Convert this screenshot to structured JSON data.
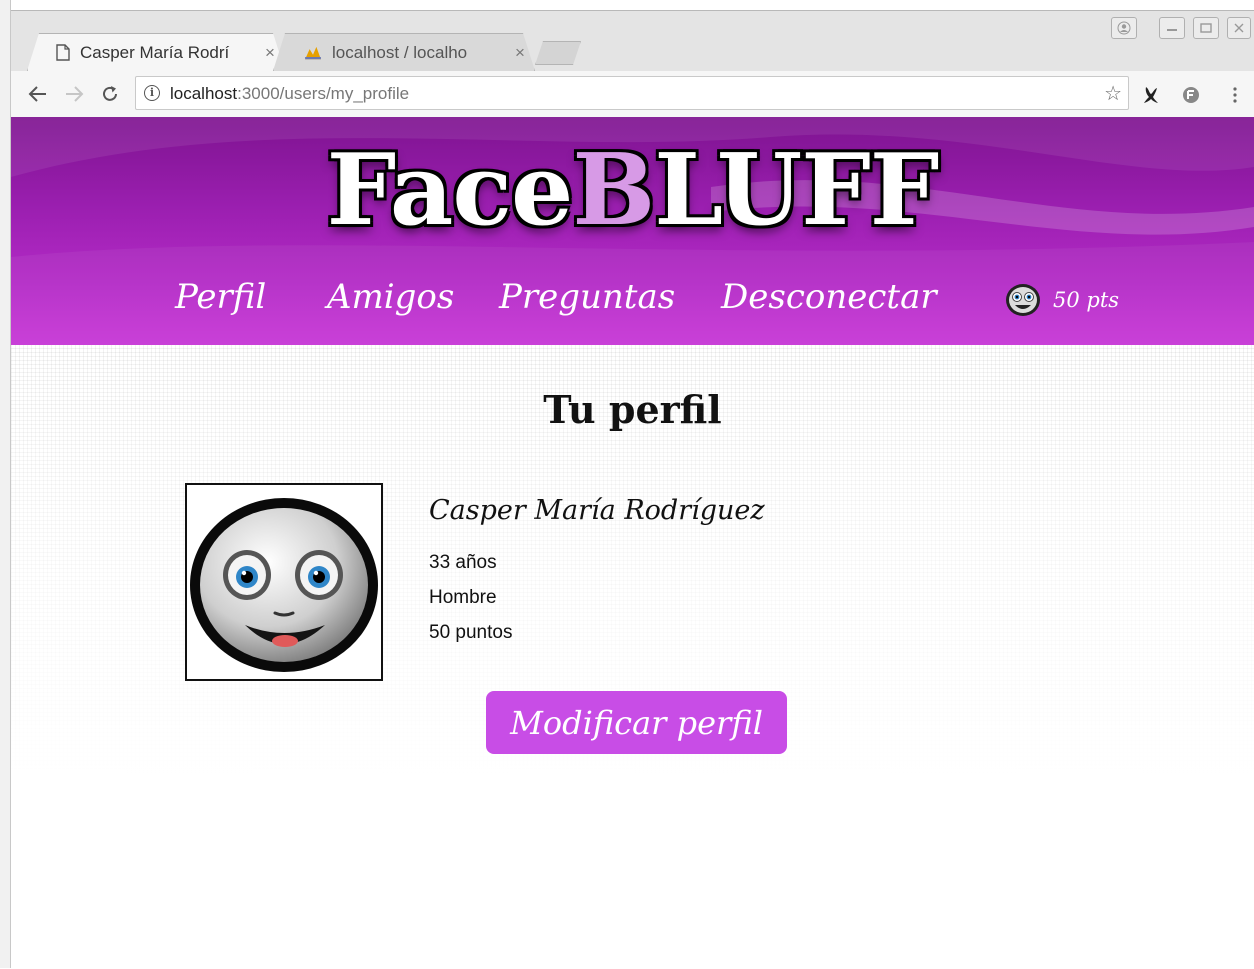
{
  "browser": {
    "tabs": [
      {
        "title": "Casper María Rodrí",
        "close": "×"
      },
      {
        "title": "localhost / localho",
        "close": "×"
      }
    ],
    "url_host": "localhost",
    "url_rest": ":3000/users/my_profile"
  },
  "site": {
    "logo_part1": "Face",
    "logo_accent": "B",
    "logo_part2": "LUFF",
    "nav": [
      "Perfil",
      "Amigos",
      "Preguntas",
      "Desconectar"
    ],
    "score": "50 pts"
  },
  "profile": {
    "title": "Tu perfil",
    "name": "Casper María Rodríguez",
    "age": "33 años",
    "gender": "Hombre",
    "points": "50 puntos",
    "edit_button": "Modificar perfil"
  },
  "colors": {
    "header": "#9b1fb0",
    "button": "#c84de6"
  }
}
